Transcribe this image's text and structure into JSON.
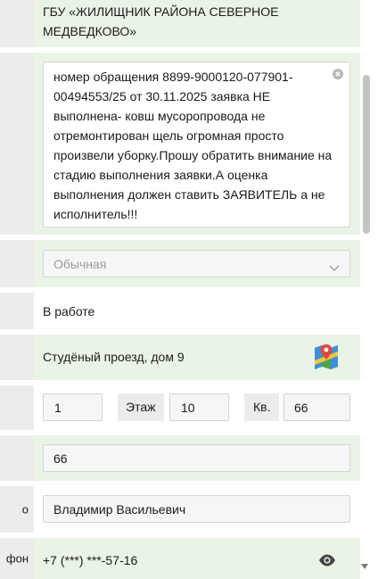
{
  "organization": "ГБУ «ЖИЛИЩНИК РАЙОНА СЕВЕРНОЕ МЕДВЕДКОВО»",
  "message_text": "номер обращения 8899-9000120-077901-00494553/25 от 30.11.2025 заявка НЕ выполнена- ковш мусоропровода не отремонтирован щель огромная просто произвели уборку.Прошу обратить внимание на стадию выполнения заявки.А оценка выполнения должен ставить ЗАЯВИТЕЛЬ а не исполнитель!!!",
  "message_lines": [
    "номер обращения 8899-9000120-077901-",
    "00494553/25 от 30.11.2025 заявка НЕ",
    "выполнена- ковш мусоропровода не",
    "отремонтирован щель огромная просто",
    "произвели уборку.Прошу обратить внимание на",
    "стадию выполнения заявки.А оценка",
    "выполнения должен ставить ЗАЯВИТЕЛЬ а не",
    "исполнитель!!!"
  ],
  "priority_select": "Обычная",
  "status": "В работе",
  "address": "Студёный проезд, дом 9",
  "entrance": "1",
  "floor_label": "Этаж",
  "floor": "10",
  "apartment_label": "Кв.",
  "apartment": "66",
  "apartment_field": "66",
  "contact_label_fragment": "о",
  "contact_name": "Владимир Васильевич",
  "phone_label_fragment": "фон",
  "phone": "+7 (***) ***-57-16",
  "icons": {
    "clear": "clear-circle-x-icon",
    "dropdown": "chevron-down-icon",
    "map": "map-pin-icon",
    "reveal": "eye-icon"
  },
  "colors": {
    "row_green": "#eaf4e6",
    "label_gray": "#ececec",
    "border": "#d4d4d4"
  }
}
